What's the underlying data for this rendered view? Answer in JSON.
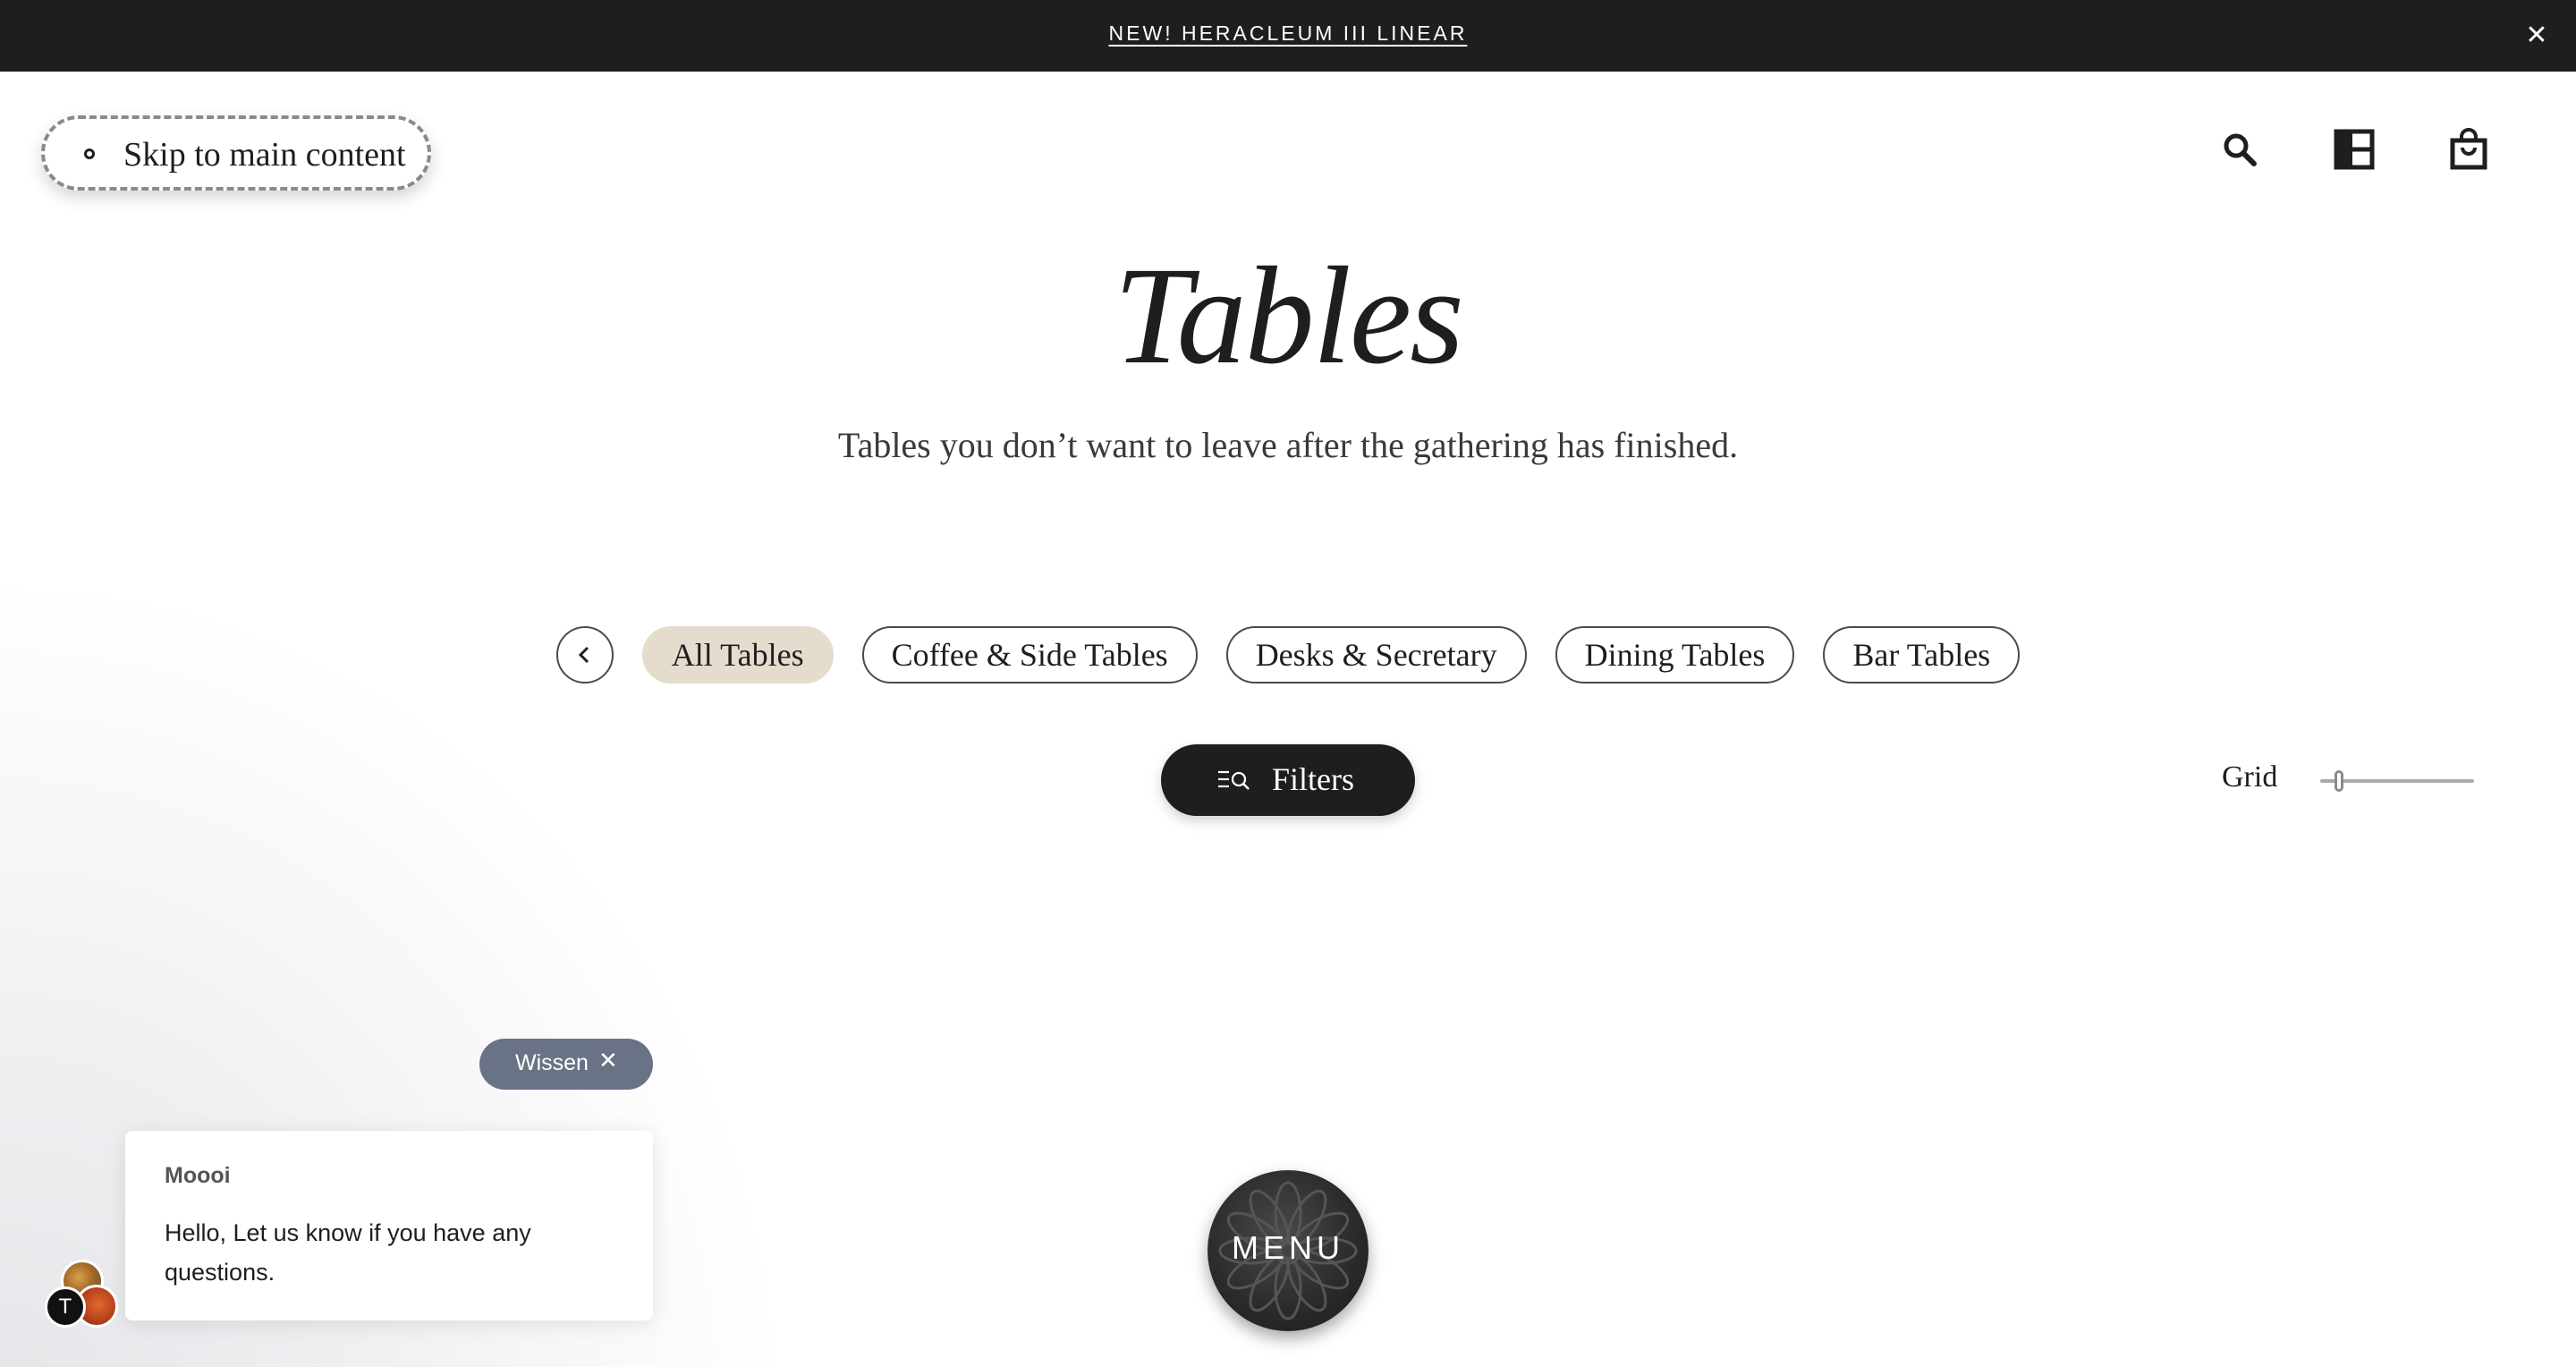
{
  "announcement": {
    "text": "NEW! HERACLEUM III LINEAR",
    "close_icon": "close-icon"
  },
  "skip_link": {
    "label": "Skip to main content"
  },
  "header_icons": [
    "search-icon",
    "layout-icon",
    "shopping-bag-icon"
  ],
  "page": {
    "title": "Tables",
    "subtitle": "Tables you don’t want to leave after the gathering has finished."
  },
  "categories": {
    "back_icon": "chevron-left-icon",
    "items": [
      "All Tables",
      "Coffee & Side Tables",
      "Desks & Secretary",
      "Dining Tables",
      "Bar Tables"
    ],
    "active_index": 0
  },
  "filters": {
    "label": "Filters",
    "icon": "filter-icon"
  },
  "grid": {
    "label": "Grid",
    "slider_level": 0.1
  },
  "chat": {
    "dismiss_label": "Wissen",
    "sender": "Moooi",
    "message": "Hello, Let us know if you have any questions.",
    "avatar_letter": "T"
  },
  "menu": {
    "label": "MENU"
  },
  "colors": {
    "dark": "#1e1e1e",
    "chip_active": "#e4dccc",
    "wissen_bg": "#6a7385"
  }
}
